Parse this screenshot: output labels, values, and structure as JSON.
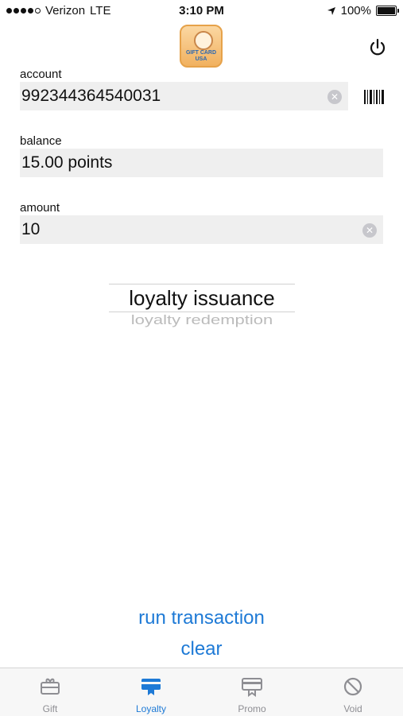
{
  "status_bar": {
    "carrier": "Verizon",
    "network": "LTE",
    "time": "3:10 PM",
    "battery": "100%"
  },
  "header": {
    "logo_text_line1": "GIFT CARD",
    "logo_text_line2": "USA",
    "power_icon": "power-icon"
  },
  "form": {
    "account": {
      "label": "account",
      "value": "992344364540031"
    },
    "balance": {
      "label": "balance",
      "value": "15.00 points"
    },
    "amount": {
      "label": "amount",
      "value": "10"
    }
  },
  "picker": {
    "selected": "loyalty issuance",
    "options": [
      "loyalty issuance",
      "loyalty redemption"
    ]
  },
  "actions": {
    "run_label": "run transaction",
    "clear_label": "clear"
  },
  "tabs": [
    {
      "label": "Gift",
      "icon": "gift-icon",
      "active": false
    },
    {
      "label": "Loyalty",
      "icon": "loyalty-card-icon",
      "active": true
    },
    {
      "label": "Promo",
      "icon": "promo-card-icon",
      "active": false
    },
    {
      "label": "Void",
      "icon": "void-icon",
      "active": false
    }
  ],
  "colors": {
    "accent": "#1e7ad6",
    "field_bg": "#efefef",
    "inactive_tab": "#8e8e93"
  }
}
